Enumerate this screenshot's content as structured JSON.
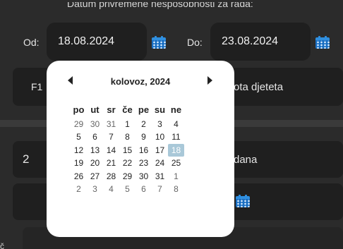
{
  "header": {
    "title": "Datum privremene nesposobnosti za rada:"
  },
  "from": {
    "label": "Od:",
    "value": "18.08.2024"
  },
  "to": {
    "label": "Do:",
    "value": "23.08.2024"
  },
  "row1": {
    "code": "F1",
    "text": "ota djeteta"
  },
  "row2": {
    "count": "2",
    "unit": "dana"
  },
  "bottom_label_fragment": "č",
  "icons": {
    "calendar": "calendar-icon"
  },
  "colors": {
    "accent": "#2f8fe0",
    "selected": "#a9c8d8",
    "background": "#2b2b2b"
  },
  "calendar": {
    "month_label": "kolovoz, 2024",
    "weekdays": [
      "po",
      "ut",
      "sr",
      "če",
      "pe",
      "su",
      "ne"
    ],
    "weeks": [
      [
        {
          "d": "29",
          "o": true
        },
        {
          "d": "30",
          "o": true
        },
        {
          "d": "31",
          "o": true
        },
        {
          "d": "1"
        },
        {
          "d": "2"
        },
        {
          "d": "3"
        },
        {
          "d": "4"
        }
      ],
      [
        {
          "d": "5"
        },
        {
          "d": "6"
        },
        {
          "d": "7"
        },
        {
          "d": "8"
        },
        {
          "d": "9"
        },
        {
          "d": "10"
        },
        {
          "d": "11"
        }
      ],
      [
        {
          "d": "12"
        },
        {
          "d": "13"
        },
        {
          "d": "14"
        },
        {
          "d": "15"
        },
        {
          "d": "16"
        },
        {
          "d": "17"
        },
        {
          "d": "18",
          "s": true
        }
      ],
      [
        {
          "d": "19"
        },
        {
          "d": "20"
        },
        {
          "d": "21"
        },
        {
          "d": "22"
        },
        {
          "d": "23"
        },
        {
          "d": "24"
        },
        {
          "d": "25"
        }
      ],
      [
        {
          "d": "26"
        },
        {
          "d": "27"
        },
        {
          "d": "28"
        },
        {
          "d": "29"
        },
        {
          "d": "30"
        },
        {
          "d": "31"
        },
        {
          "d": "1",
          "o": true
        }
      ],
      [
        {
          "d": "2",
          "o": true
        },
        {
          "d": "3",
          "o": true
        },
        {
          "d": "4",
          "o": true
        },
        {
          "d": "5",
          "o": true
        },
        {
          "d": "6",
          "o": true
        },
        {
          "d": "7",
          "o": true
        },
        {
          "d": "8",
          "o": true
        }
      ]
    ]
  }
}
